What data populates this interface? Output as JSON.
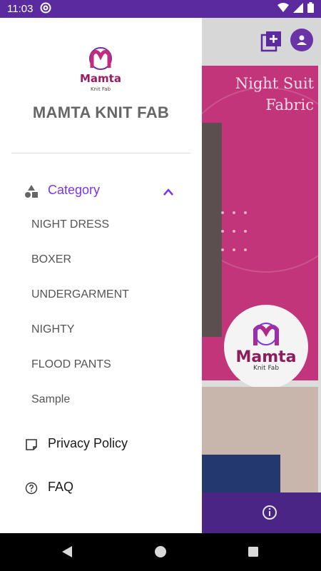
{
  "status_bar": {
    "time": "11:03"
  },
  "app": {
    "banner_title_line1": "Night Suit",
    "banner_title_line2": "Fabric",
    "banner_logo_word": "Mamta",
    "banner_logo_sub": "Knit Fab"
  },
  "drawer": {
    "logo_word": "Mamta",
    "logo_sub": "Knit Fab",
    "brand_name": "MAMTA KNIT FAB",
    "category": {
      "label": "Category",
      "expanded": true,
      "items": [
        "NIGHT DRESS",
        "BOXER",
        "UNDERGARMENT",
        "NIGHTY",
        "FLOOD PANTS",
        "Sample"
      ]
    },
    "privacy_label": "Privacy Policy",
    "faq_label": "FAQ"
  },
  "colors": {
    "accent": "#7b35e6",
    "primary_dark": "#5b2a9e",
    "banner": "#c2357a"
  },
  "icons": {
    "status": [
      "at-sign-icon",
      "wifi-icon",
      "signal-icon",
      "battery-icon"
    ],
    "toolbar": [
      "add-box-icon",
      "profile-icon"
    ],
    "drawer": [
      "category-shapes-icon",
      "chevron-up-icon",
      "note-icon",
      "help-circle-icon"
    ],
    "nav": [
      "back-icon",
      "home-icon",
      "recents-icon"
    ]
  }
}
